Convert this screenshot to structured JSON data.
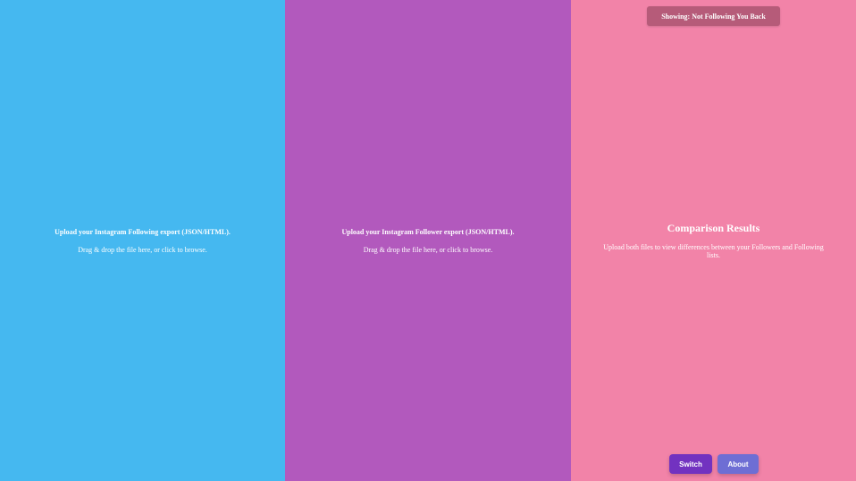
{
  "following_panel": {
    "title": "Upload your Instagram Following export (JSON/HTML).",
    "hint": "Drag & drop the file here, or click to browse."
  },
  "follower_panel": {
    "title": "Upload your Instagram Follower export (JSON/HTML).",
    "hint": "Drag & drop the file here, or click to browse."
  },
  "results_panel": {
    "filter_badge": "Showing: Not Following You Back",
    "title": "Comparison Results",
    "description": "Upload both files to view differences between your Followers and Following lists."
  },
  "buttons": {
    "switch_label": "Switch",
    "about_label": "About"
  },
  "colors": {
    "following_bg": "#45b8f0",
    "follower_bg": "#b259bd",
    "results_bg": "#f283a8",
    "badge_bg": "#b65b79",
    "switch_bg": "#7232c0",
    "about_bg": "#6e6ed4"
  }
}
